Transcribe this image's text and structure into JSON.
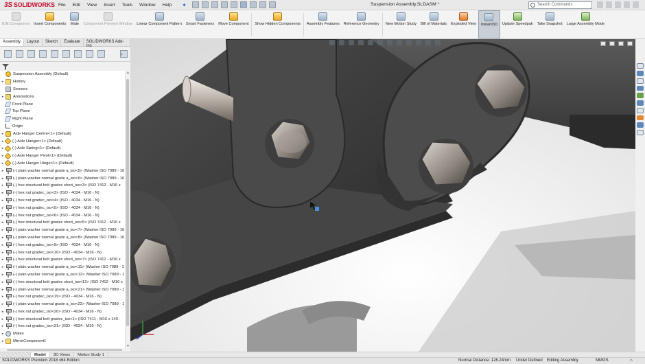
{
  "app": {
    "brand": "SOLIDWORKS",
    "document_title": "Suspension Assembly.SLDASM *",
    "search_placeholder": "Search Commands"
  },
  "menu": [
    "File",
    "Edit",
    "View",
    "Insert",
    "Tools",
    "Window",
    "Help"
  ],
  "ribbon": [
    {
      "label": "Edit Component",
      "state": "disabled"
    },
    {
      "label": "Insert Components",
      "state": "normal"
    },
    {
      "label": "Mate",
      "state": "normal"
    },
    {
      "label": "Component Preview Window",
      "state": "disabled"
    },
    {
      "label": "Linear Component Pattern",
      "state": "normal"
    },
    {
      "label": "Smart Fasteners",
      "state": "normal"
    },
    {
      "label": "Move Component",
      "state": "normal"
    },
    {
      "label": "Show Hidden Components",
      "state": "normal"
    },
    {
      "label": "Assembly Features",
      "state": "normal"
    },
    {
      "label": "Reference Geometry",
      "state": "normal"
    },
    {
      "label": "New Motion Study",
      "state": "normal"
    },
    {
      "label": "Bill of Materials",
      "state": "normal"
    },
    {
      "label": "Exploded View",
      "state": "normal"
    },
    {
      "label": "Instant3D",
      "state": "active"
    },
    {
      "label": "Update Speedpak",
      "state": "normal"
    },
    {
      "label": "Take Snapshot",
      "state": "normal"
    },
    {
      "label": "Large Assembly Mode",
      "state": "normal"
    }
  ],
  "tabs": [
    "Assembly",
    "Layout",
    "Sketch",
    "Evaluate",
    "SOLIDWORKS Add-Ins"
  ],
  "tree": [
    {
      "label": "Suspension Assembly  (Default)",
      "icon": "asm",
      "expander": ""
    },
    {
      "label": "History",
      "icon": "fold",
      "expander": "▸"
    },
    {
      "label": "Sensors",
      "icon": "sens",
      "expander": ""
    },
    {
      "label": "Annotations",
      "icon": "ann",
      "expander": "▸"
    },
    {
      "label": "Front Plane",
      "icon": "plane",
      "expander": ""
    },
    {
      "label": "Top Plane",
      "icon": "plane",
      "expander": ""
    },
    {
      "label": "Right Plane",
      "icon": "plane",
      "expander": ""
    },
    {
      "label": "Origin",
      "icon": "orig",
      "expander": ""
    },
    {
      "label": "Axle Hanger Centre<1> (Default)",
      "icon": "part",
      "expander": "▸"
    },
    {
      "label": "(-) Axle Hanger<1> (Default)",
      "icon": "part2",
      "expander": "▸"
    },
    {
      "label": "(-) Axle Spring<1> (Default)",
      "icon": "part2",
      "expander": "▸"
    },
    {
      "label": "(-) Axle Hanger Pivot<1> (Default)",
      "icon": "part2",
      "expander": "▸"
    },
    {
      "label": "(-) Axle Hanger Hinge<1> (Default)",
      "icon": "part2",
      "expander": "▸"
    },
    {
      "label": "(-) plain washer normal grade a_iso<5> (Washer ISO 7089 - 16",
      "icon": "bolt",
      "expander": "▸"
    },
    {
      "label": "(-) plain washer normal grade a_iso<6> (Washer ISO 7089 - 16",
      "icon": "bolt",
      "expander": "▸"
    },
    {
      "label": "(-) hex structural bolt gradec short_iso<3> (ISO 7412 - M16 x",
      "icon": "bolt",
      "expander": "▸"
    },
    {
      "label": "(-) hex nut gradec_iso<3> (ISO - 4034 - M16 - N)",
      "icon": "bolt",
      "expander": "▸"
    },
    {
      "label": "(-) hex nut gradec_iso<4> (ISO - 4034 - M16 - N)",
      "icon": "bolt",
      "expander": "▸"
    },
    {
      "label": "(-) hex nut gradec_iso<5> (ISO - 4034 - M16 - N)",
      "icon": "bolt",
      "expander": "▸"
    },
    {
      "label": "(-) hex nut gradec_iso<6> (ISO - 4034 - M16 - N)",
      "icon": "bolt",
      "expander": "▸"
    },
    {
      "label": "(-) hex structural bolt gradec short_iso<5> (ISO 7412 - M16 x",
      "icon": "bolt",
      "expander": "▸"
    },
    {
      "label": "(-) plain washer normal grade a_iso<7> (Washer ISO 7089 - 16",
      "icon": "bolt",
      "expander": "▸"
    },
    {
      "label": "(-) plain washer normal grade a_iso<8> (Washer ISO 7089 - 16",
      "icon": "bolt",
      "expander": "▸"
    },
    {
      "label": "(-) hex nut gradec_iso<9> (ISO - 4034 - M16 - N)",
      "icon": "bolt",
      "expander": "▸"
    },
    {
      "label": "(-) hex nut gradec_iso<10> (ISO - 4034 - M16 - N)",
      "icon": "bolt",
      "expander": "▸"
    },
    {
      "label": "(-) hex structural bolt gradec short_iso<7> (ISO 7412 - M16 x",
      "icon": "bolt",
      "expander": "▸"
    },
    {
      "label": "(-) plain washer normal grade a_iso<11> (Washer ISO 7089 - 1",
      "icon": "bolt",
      "expander": "▸"
    },
    {
      "label": "(-) plain washer normal grade a_iso<12> (Washer ISO 7089 - 1",
      "icon": "bolt",
      "expander": "▸"
    },
    {
      "label": "(-) hex structural bolt gradec short_iso<12> (ISO 7412 - M16 x",
      "icon": "bolt",
      "expander": "▸"
    },
    {
      "label": "(-) plain washer normal grade a_iso<21> (Washer ISO 7089 - 1",
      "icon": "bolt",
      "expander": "▸"
    },
    {
      "label": "(-) hex nut gradec_iso<19> (ISO - 4034 - M16 - N)",
      "icon": "bolt",
      "expander": "▸"
    },
    {
      "label": "(-) plain washer normal grade a_iso<22> (Washer ISO 7089 - 1",
      "icon": "bolt",
      "expander": "▸"
    },
    {
      "label": "(-) hex nut gradec_iso<20> (ISO - 4034 - M16 - N)",
      "icon": "bolt",
      "expander": "▸"
    },
    {
      "label": "(-) hex structural bolt gradec_iso<1> (ISO 7411 - M16 x 140 -",
      "icon": "bolt",
      "expander": "▸"
    },
    {
      "label": "(-) hex nut gradec_iso<21> (ISO - 4034 - M16 - N)",
      "icon": "bolt",
      "expander": "▸"
    },
    {
      "label": "Mates",
      "icon": "mates",
      "expander": "▸"
    },
    {
      "label": "MirrorComponent1",
      "icon": "fold",
      "expander": "▸"
    }
  ],
  "bottom_tabs": [
    "Model",
    "3D Views",
    "Motion Study 1"
  ],
  "status": {
    "edition": "SOLIDWORKS Premium 2018 x64 Edition",
    "distance": "Normal Distance: 126.24mm",
    "definition": "Under Defined",
    "mode": "Editing Assembly",
    "units": "MMGS"
  }
}
